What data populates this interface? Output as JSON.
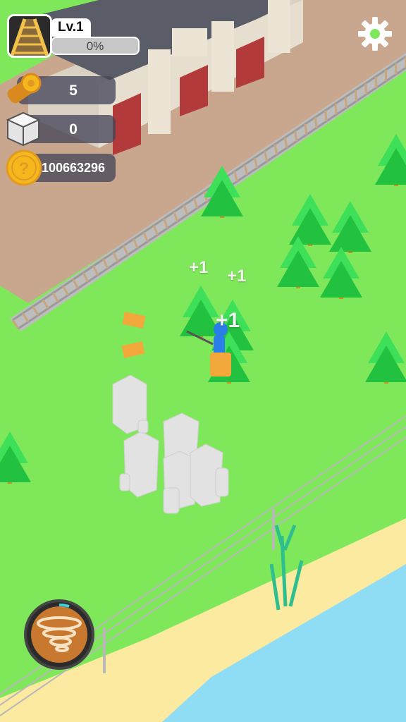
{
  "level": {
    "label": "Lv.1",
    "progress_text": "0%",
    "progress": 0
  },
  "resources": {
    "wood": {
      "value": "5",
      "icon": "wood-log-icon"
    },
    "stone": {
      "value": "0",
      "icon": "stone-block-icon"
    },
    "coins": {
      "value": "100663296",
      "icon": "gold-coin-icon"
    }
  },
  "settings": {
    "icon": "gear-icon"
  },
  "floating_texts": [
    "+1",
    "+1",
    "+1"
  ],
  "skill": {
    "icon": "tornado-icon"
  },
  "colors": {
    "grass": "#7fe85a",
    "station_ground": "#c9a78f",
    "water": "#8fdcf5",
    "sand": "#fbeaa0",
    "tree": "#2fd24a",
    "coin": "#f5b81c"
  }
}
